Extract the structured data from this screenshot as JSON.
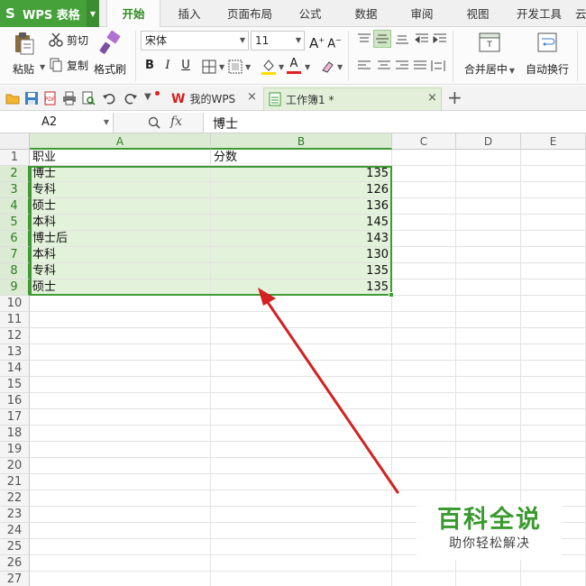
{
  "app": {
    "name": "WPS 表格"
  },
  "menu": {
    "tabs": [
      "开始",
      "插入",
      "页面布局",
      "公式",
      "数据",
      "审阅",
      "视图",
      "开发工具",
      "云"
    ]
  },
  "ribbon": {
    "paste": "粘贴",
    "cut": "剪切",
    "copy": "复制",
    "format_painter": "格式刷",
    "font_name": "宋体",
    "font_size": "11",
    "merge_center": "合并居中",
    "wrap_text": "自动换行"
  },
  "doc_tabs": {
    "home": "我的WPS",
    "workbook": "工作簿1 *"
  },
  "formula_bar": {
    "cell_ref": "A2",
    "fx_label": "fx",
    "content": "博士"
  },
  "sheet": {
    "columns": [
      "A",
      "B",
      "C",
      "D",
      "E"
    ],
    "rows": [
      [
        "职业",
        "分数"
      ],
      [
        "博士",
        "135"
      ],
      [
        "专科",
        "126"
      ],
      [
        "硕士",
        "136"
      ],
      [
        "本科",
        "145"
      ],
      [
        "博士后",
        "143"
      ],
      [
        "本科",
        "130"
      ],
      [
        "专科",
        "135"
      ],
      [
        "硕士",
        "135"
      ]
    ],
    "row_numbers": [
      "1",
      "2",
      "3",
      "4",
      "5",
      "6",
      "7",
      "8",
      "9",
      "10",
      "11",
      "12",
      "13",
      "14",
      "15",
      "16",
      "17",
      "18",
      "19",
      "20",
      "21",
      "22",
      "23",
      "24",
      "25",
      "26",
      "27"
    ]
  },
  "watermark": {
    "title": "百科全说",
    "subtitle": "助你轻松解决"
  },
  "colors": {
    "accent": "#46a13a",
    "selection": "#e3f2db",
    "arrow": "#d42020"
  }
}
